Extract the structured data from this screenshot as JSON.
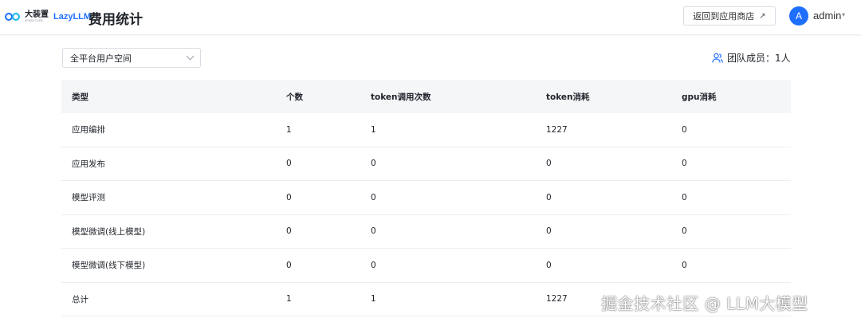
{
  "brand": {
    "logo_cn": "大装置",
    "logo_en": "SENSECORE",
    "logo_lazy": "LazyLLM"
  },
  "header": {
    "title": "费用统计",
    "back_button": "返回到应用商店",
    "back_icon": "external-arrow-icon",
    "user": {
      "avatar_letter": "A",
      "name": "admin"
    }
  },
  "filter": {
    "workspace_select": "全平台用户空间"
  },
  "team": {
    "label": "团队成员：1人",
    "icon": "users-icon"
  },
  "table": {
    "columns": [
      "类型",
      "个数",
      "token调用次数",
      "token消耗",
      "gpu消耗"
    ],
    "rows": [
      [
        "应用编排",
        "1",
        "1",
        "1227",
        "0"
      ],
      [
        "应用发布",
        "0",
        "0",
        "0",
        "0"
      ],
      [
        "模型评测",
        "0",
        "0",
        "0",
        "0"
      ],
      [
        "模型微调(线上模型)",
        "0",
        "0",
        "0",
        "0"
      ],
      [
        "模型微调(线下模型)",
        "0",
        "0",
        "0",
        "0"
      ],
      [
        "总计",
        "1",
        "1",
        "1227",
        ""
      ]
    ]
  },
  "watermark": "掘金技术社区 @ LLM大模型",
  "colors": {
    "accent": "#1f6fff",
    "header_bg": "#f5f6f8"
  }
}
